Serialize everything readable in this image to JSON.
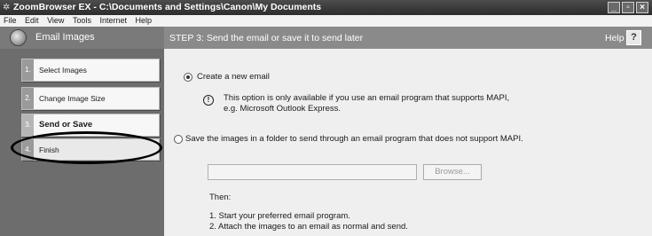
{
  "window": {
    "title": "ZoomBrowser EX  -  C:\\Documents and Settings\\Canon\\My Documents",
    "controls": {
      "minimize": "_",
      "maximize": "▫",
      "close": "×"
    }
  },
  "menu": [
    "File",
    "Edit",
    "View",
    "Tools",
    "Internet",
    "Help"
  ],
  "header": {
    "title": "Email Images",
    "step_title": "STEP 3: Send the email or save it to send later",
    "help_label": "Help",
    "help_button": "?"
  },
  "steps": [
    {
      "num": "1.",
      "label": "Select Images"
    },
    {
      "num": "2.",
      "label": "Change Image Size"
    },
    {
      "num": "3.",
      "label": "Send or Save"
    },
    {
      "num": "4.",
      "label": "Finish"
    }
  ],
  "options": {
    "new_email": {
      "label": "Create a new email",
      "note_icon": "!",
      "note_line1": "This option is only available if you use an email program that supports MAPI,",
      "note_line2": "e.g. Microsoft Outlook Express."
    },
    "save_folder": {
      "label": "Save the images in a folder to send through an email program that does not support MAPI.",
      "folder_value": "",
      "browse_label": "Browse...",
      "then_label": "Then:",
      "instructions": [
        "1.   Start your preferred email program.",
        "2.   Attach the images to an email as normal and send."
      ]
    },
    "selected": "new_email"
  }
}
